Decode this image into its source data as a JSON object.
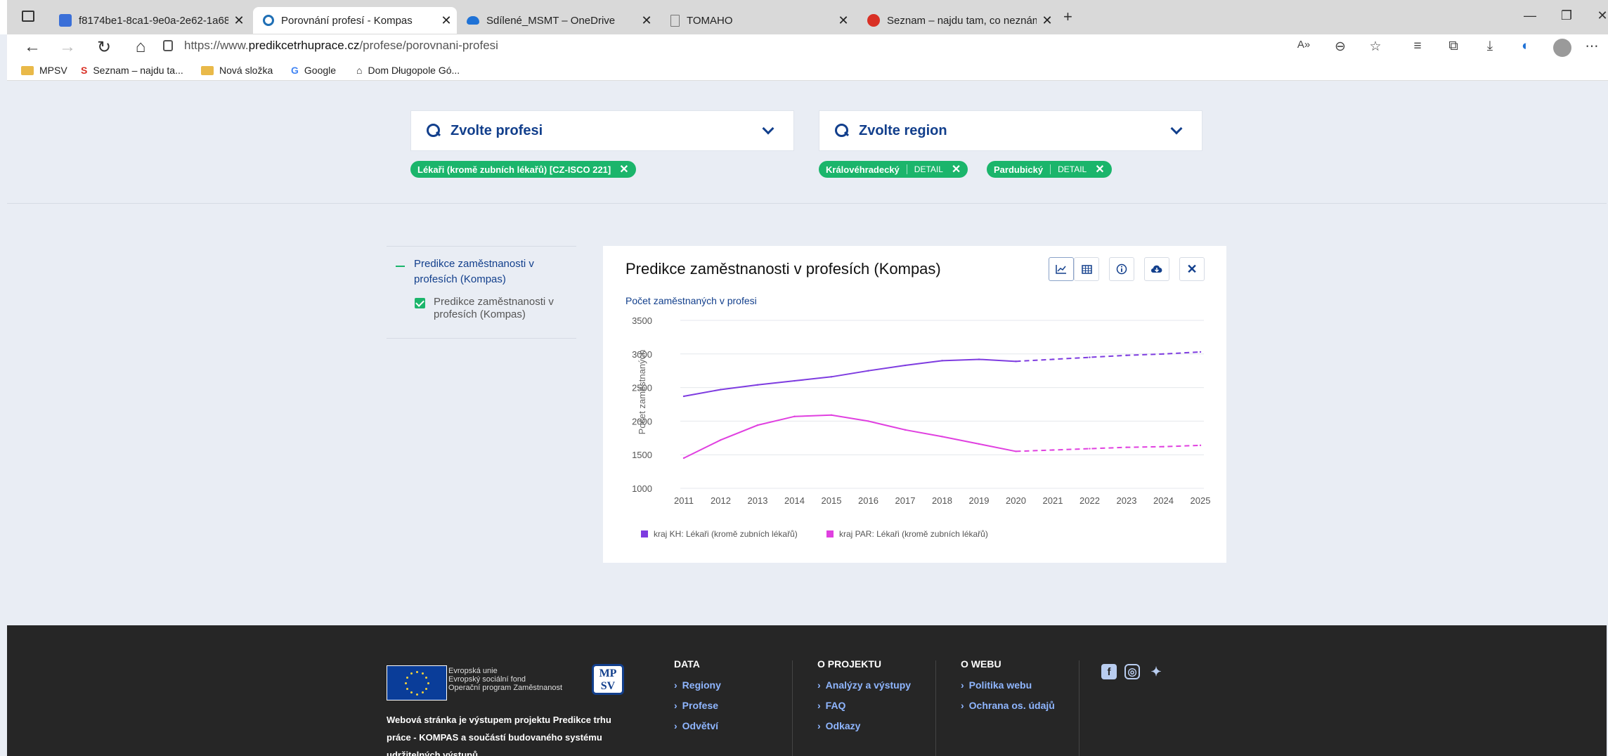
{
  "browser": {
    "tabs": [
      {
        "title": "f8174be1-8ca1-9e0a-2e62-1a68",
        "active": false
      },
      {
        "title": "Porovnání profesí - Kompas",
        "active": true
      },
      {
        "title": "Sdílené_MSMT – OneDrive",
        "active": false
      },
      {
        "title": "TOMAHO",
        "active": false
      },
      {
        "title": "Seznam – najdu tam, co neznám",
        "active": false
      }
    ],
    "url_prefix": "https://www.",
    "url_domain": "predikcetrhuprace.cz",
    "url_path": "/profese/porovnani-profesi",
    "bookmarks": [
      "MPSV",
      "Seznam – najdu ta...",
      "Nová složka",
      "Google",
      "Dom Długopole Gó..."
    ]
  },
  "filters": {
    "profession_placeholder": "Zvolte profesi",
    "region_placeholder": "Zvolte region",
    "profession_chips": [
      {
        "label": "Lékaři (kromě zubních lékařů) [CZ-ISCO 221]"
      }
    ],
    "region_chips": [
      {
        "label": "Královéhradecký",
        "detail": "DETAIL"
      },
      {
        "label": "Pardubický",
        "detail": "DETAIL"
      }
    ]
  },
  "sidepanel": {
    "group_title": "Predikce zaměstnanosti v profesích (Kompas)",
    "item_label": "Predikce zaměstnanosti v profesích (Kompas)"
  },
  "chart_data": {
    "type": "line",
    "title": "Predikce zaměstnanosti v profesích (Kompas)",
    "subtitle": "Počet zaměstnaných v profesi",
    "ylabel": "Počet zaměstnaných",
    "xlabel": "",
    "x": [
      2011,
      2012,
      2013,
      2014,
      2015,
      2016,
      2017,
      2018,
      2019,
      2020,
      2021,
      2022,
      2023,
      2024,
      2025
    ],
    "ylim": [
      1000,
      3500
    ],
    "yticks": [
      1000,
      1500,
      2000,
      2500,
      3000,
      3500
    ],
    "grid": true,
    "legend_position": "bottom-left",
    "forecast_from": 2020,
    "series": [
      {
        "name": "kraj KH: Lékaři (kromě zubních lékařů)",
        "color": "#7e3ce0",
        "values": [
          2370,
          2470,
          2540,
          2600,
          2660,
          2750,
          2830,
          2900,
          2920,
          2890,
          2920,
          2950,
          2980,
          3000,
          3030
        ]
      },
      {
        "name": "kraj PAR: Lékaři (kromě zubních lékařů)",
        "color": "#e040e0",
        "values": [
          1450,
          1720,
          1940,
          2070,
          2090,
          2000,
          1870,
          1770,
          1660,
          1550,
          1570,
          1590,
          1610,
          1620,
          1640
        ]
      }
    ]
  },
  "chart_tools": [
    "line-chart-icon",
    "table-icon",
    "info-icon",
    "download-icon",
    "close-icon"
  ],
  "footer": {
    "eu_lines": [
      "Evropská unie",
      "Evropský sociální fond",
      "Operační program Zaměstnanost"
    ],
    "mpsv_logo": "MP SV",
    "description": "Webová stránka je výstupem projektu Predikce trhu práce - KOMPAS a součástí budovaného systému udržitelných výstupů",
    "columns": [
      {
        "heading": "DATA",
        "links": [
          "Regiony",
          "Profese",
          "Odvětví"
        ]
      },
      {
        "heading": "O PROJEKTU",
        "links": [
          "Analýzy a výstupy",
          "FAQ",
          "Odkazy"
        ]
      },
      {
        "heading": "O WEBU",
        "links": [
          "Politika webu",
          "Ochrana os. údajů"
        ]
      }
    ]
  }
}
